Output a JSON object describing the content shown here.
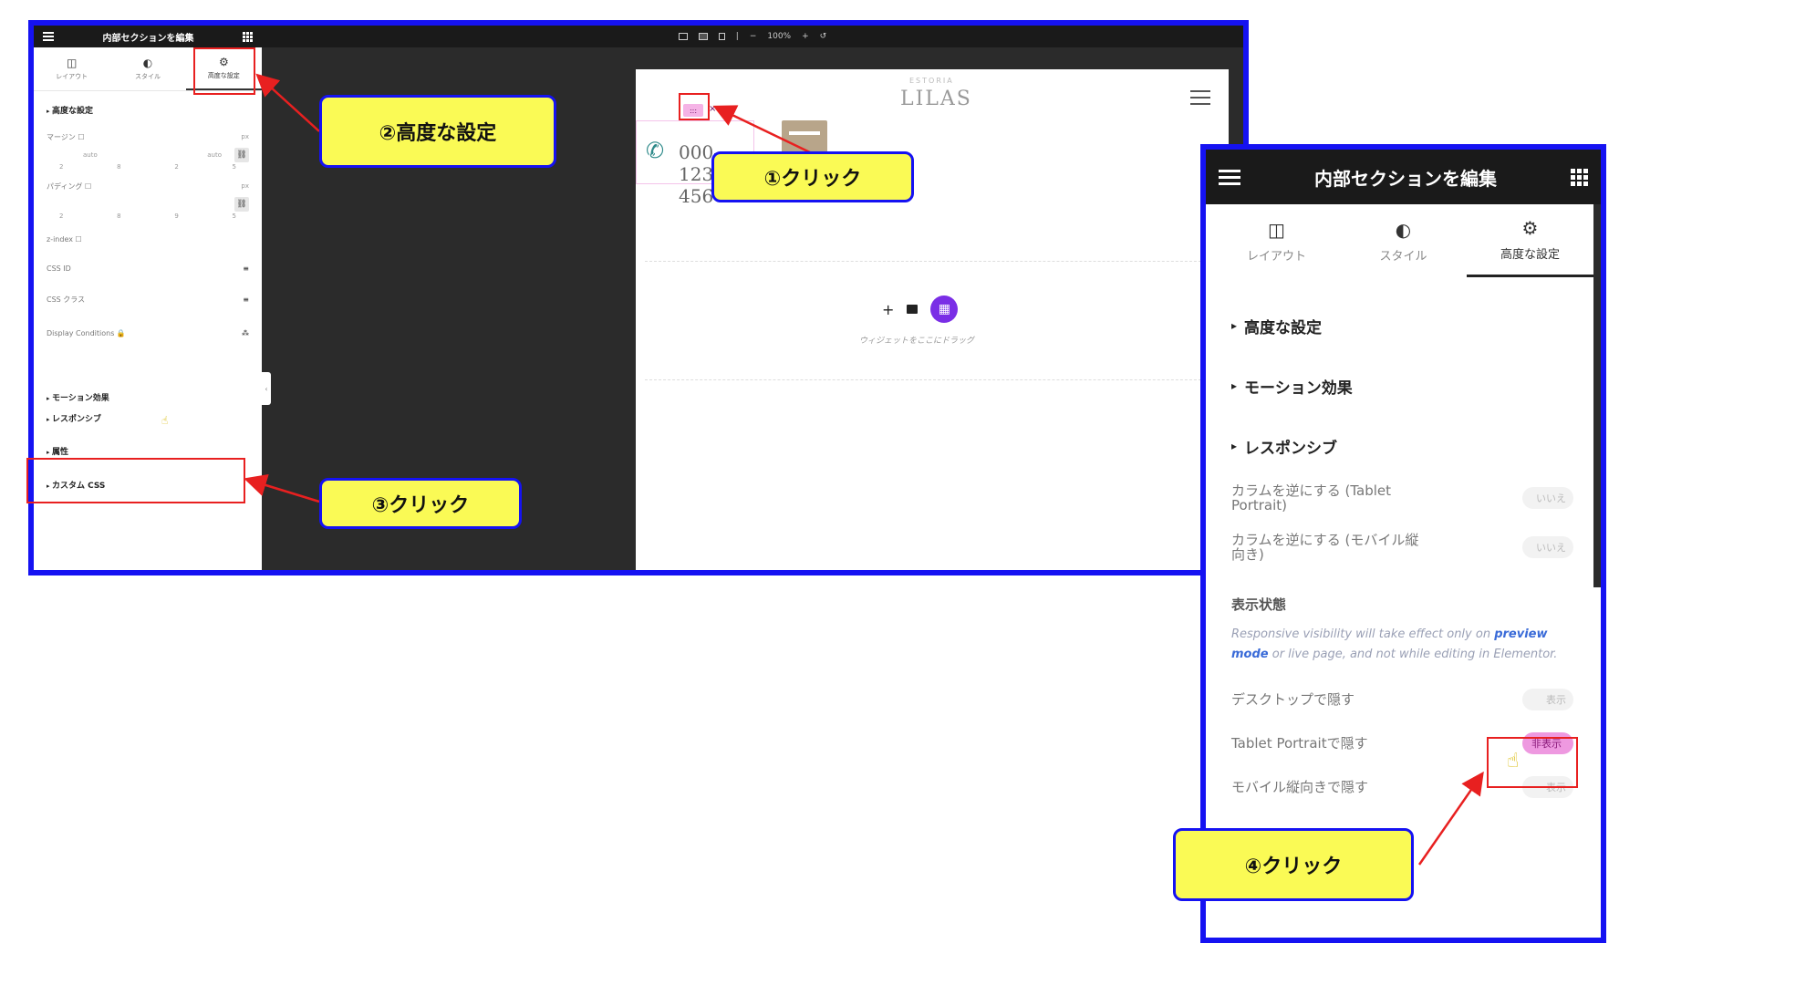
{
  "main_panel": {
    "title": "内部セクションを編集",
    "tabs": [
      {
        "label": "レイアウト",
        "icon": "columns-icon"
      },
      {
        "label": "スタイル",
        "icon": "contrast-icon"
      },
      {
        "label": "高度な設定",
        "icon": "gear-icon"
      }
    ],
    "advanced_section": "高度な設定",
    "margin_label": "マージン",
    "margin_unit": "px",
    "margin_value_left": "auto",
    "margin_value_right": "auto",
    "margin_digits": [
      "2",
      "8",
      "2",
      "5"
    ],
    "padding_label": "パディング",
    "padding_unit": "px",
    "padding_digits": [
      "2",
      "8",
      "9",
      "5"
    ],
    "zindex_label": "z-index",
    "cssid_label": "CSS ID",
    "cssclass_label": "CSS クラス",
    "display_conditions_label": "Display Conditions",
    "motion_section": "モーション効果",
    "responsive_section": "レスポンシブ",
    "attributes_section": "属性",
    "custom_css_section": "カスタム CSS"
  },
  "toolbar": {
    "zoom": "100%",
    "minus": "−",
    "plus": "+",
    "undo": "↺"
  },
  "preview": {
    "logo_sub": "ESTORIA",
    "logo": "LILAS",
    "handle": ":::",
    "close": "×",
    "phone": "000-123-456",
    "drag_hint": "ウィジェットをここにドラッグ"
  },
  "zoom_panel": {
    "title": "内部セクションを編集",
    "tabs": [
      {
        "label": "レイアウト",
        "icon": "columns-icon"
      },
      {
        "label": "スタイル",
        "icon": "contrast-icon"
      },
      {
        "label": "高度な設定",
        "icon": "gear-icon"
      }
    ],
    "sections": [
      "高度な設定",
      "モーション効果",
      "レスポンシブ"
    ],
    "reverse_tablet_label": "カラムを逆にする (Tablet Portrait)",
    "reverse_mobile_label": "カラムを逆にする (モバイル縦向き)",
    "toggle_off_label": "いいえ",
    "visibility_title": "表示状態",
    "note_pre": "Responsive visibility will take effect only on ",
    "note_link": "preview mode",
    "note_post": " or live page, and not while editing in Elementor.",
    "hide_desktop_label": "デスクトップで隠す",
    "hide_tablet_label": "Tablet Portraitで隠す",
    "hide_mobile_label": "モバイル縦向きで隠す",
    "show_label": "表示",
    "hidden_label": "非表示"
  },
  "callouts": {
    "step1": "①クリック",
    "step2": "②高度な設定",
    "step3": "③クリック",
    "step4": "④クリック"
  },
  "colors": {
    "frame": "#1512f2",
    "callout_bg": "#fafa55",
    "highlight": "#e82020",
    "accent_pink": "#ee99e0",
    "kit_purple": "#7a2ee6"
  }
}
